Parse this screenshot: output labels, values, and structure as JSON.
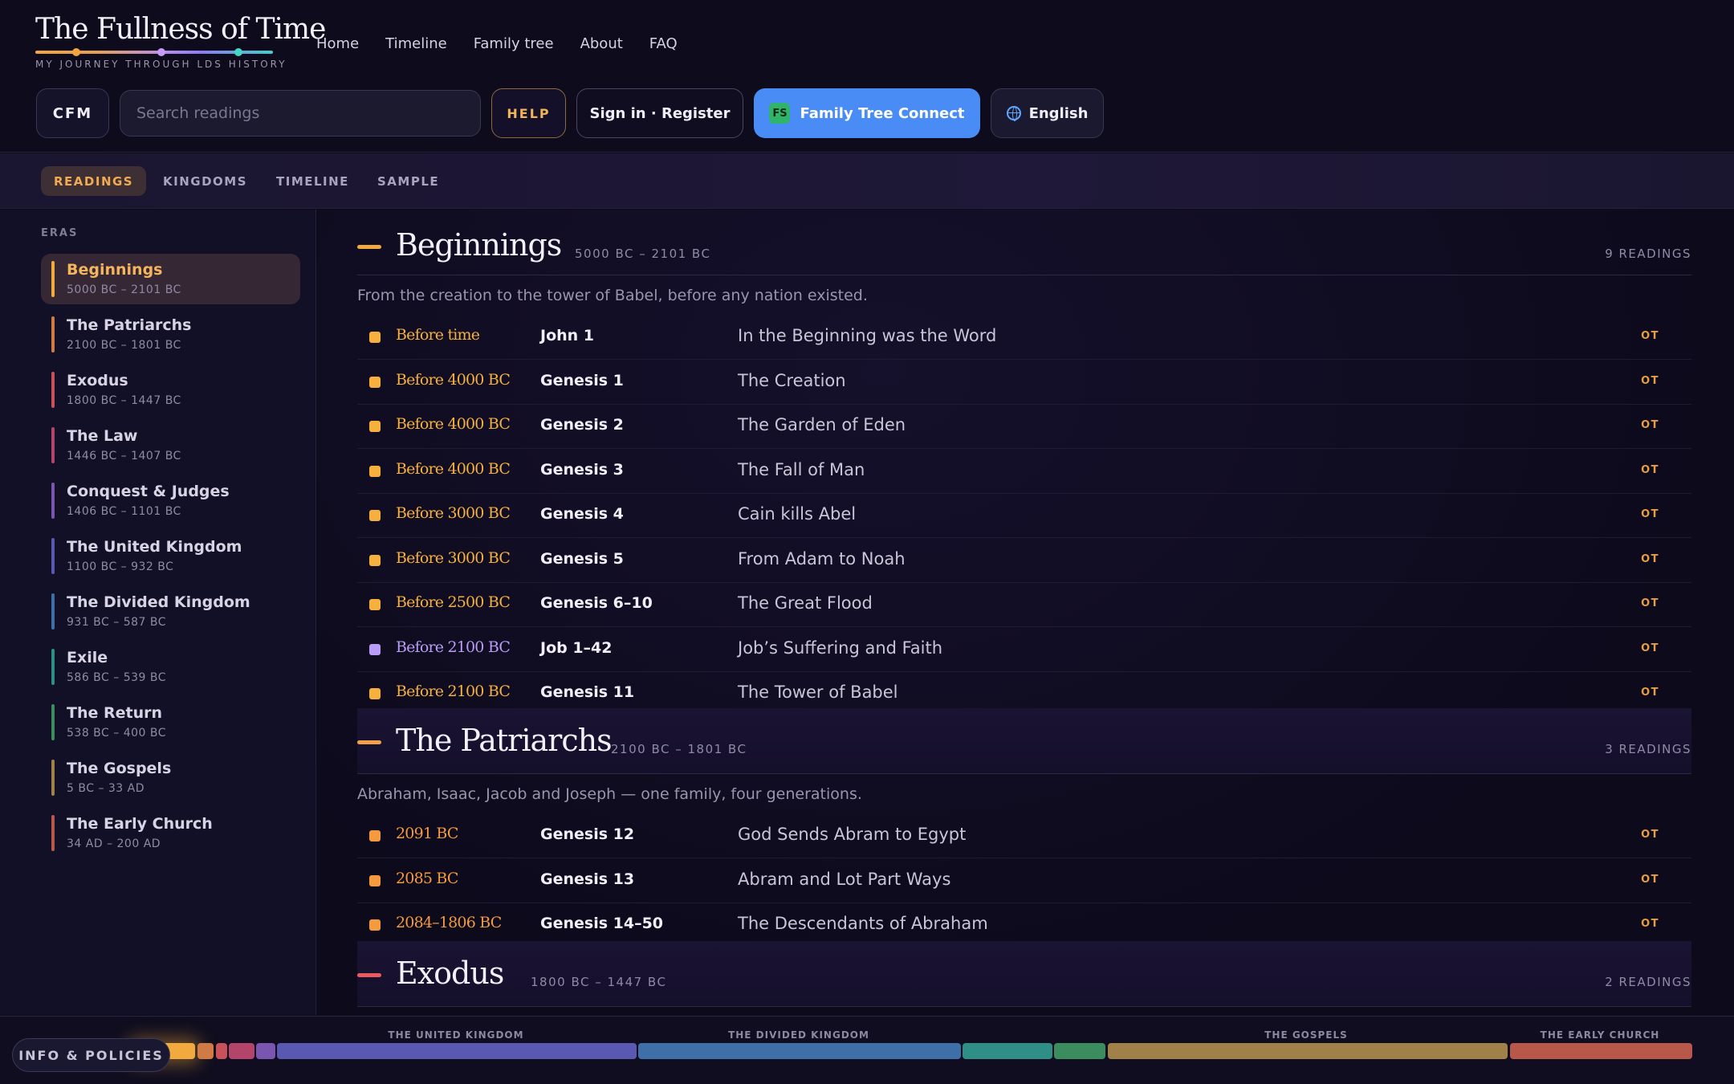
{
  "brand": {
    "title": "The Fullness of Time",
    "subtitle": "MY JOURNEY THROUGH LDS HISTORY"
  },
  "nav": [
    "Home",
    "Timeline",
    "Family tree",
    "About",
    "FAQ"
  ],
  "toolbar": {
    "cfm": "CFM",
    "search_placeholder": "Search readings",
    "help": "HELP",
    "sign_in": "Sign in · Register",
    "family_tree_connect": "Family Tree Connect",
    "fs_badge": "FS",
    "language": "English"
  },
  "tabs": [
    "READINGS",
    "KINGDOMS",
    "TIMELINE",
    "SAMPLE"
  ],
  "sidebar": {
    "label": "ERAS",
    "eras": [
      {
        "name": "Beginnings",
        "range": "5000 BC – 2101 BC",
        "color": "#f2a93e"
      },
      {
        "name": "The Patriarchs",
        "range": "2100 BC – 1801 BC",
        "color": "#d07a45"
      },
      {
        "name": "Exodus",
        "range": "1800 BC – 1447 BC",
        "color": "#c9515a"
      },
      {
        "name": "The Law",
        "range": "1446 BC – 1407 BC",
        "color": "#b4456a"
      },
      {
        "name": "Conquest & Judges",
        "range": "1406 BC – 1101 BC",
        "color": "#7a56b0"
      },
      {
        "name": "The United Kingdom",
        "range": "1100 BC – 932 BC",
        "color": "#5a58b0"
      },
      {
        "name": "The Divided Kingdom",
        "range": "931 BC – 587 BC",
        "color": "#3f6fa8"
      },
      {
        "name": "Exile",
        "range": "586 BC – 539 BC",
        "color": "#2f8f86"
      },
      {
        "name": "The Return",
        "range": "538 BC – 400 BC",
        "color": "#3c8d5e"
      },
      {
        "name": "The Gospels",
        "range": "5 BC – 33 AD",
        "color": "#a0814a"
      },
      {
        "name": "The Early Church",
        "range": "34 AD – 200 AD",
        "color": "#b7584a"
      }
    ]
  },
  "sections": [
    {
      "title": "Beginnings",
      "range": "5000 BC – 2101 BC",
      "count": "9 READINGS",
      "description": "From the creation to the tower of Babel, before any nation existed.",
      "color": "#f2a93e",
      "readings": [
        {
          "date": "Before time",
          "ref": "John 1",
          "title": "In the Beginning was the Word",
          "tag": "OT",
          "color": "#f5b03e"
        },
        {
          "date": "Before 4000 BC",
          "ref": "Genesis 1",
          "title": "The Creation",
          "tag": "OT",
          "color": "#f5b03e"
        },
        {
          "date": "Before 4000 BC",
          "ref": "Genesis 2",
          "title": "The Garden of Eden",
          "tag": "OT",
          "color": "#f5b03e"
        },
        {
          "date": "Before 4000 BC",
          "ref": "Genesis 3",
          "title": "The Fall of Man",
          "tag": "OT",
          "color": "#f5b03e"
        },
        {
          "date": "Before 3000 BC",
          "ref": "Genesis 4",
          "title": "Cain kills Abel",
          "tag": "OT",
          "color": "#f5b03e"
        },
        {
          "date": "Before 3000 BC",
          "ref": "Genesis 5",
          "title": "From Adam to Noah",
          "tag": "OT",
          "color": "#f5b03e"
        },
        {
          "date": "Before 2500 BC",
          "ref": "Genesis 6–10",
          "title": "The Great Flood",
          "tag": "OT",
          "color": "#f5b03e"
        },
        {
          "date": "Before 2100 BC",
          "ref": "Job 1–42",
          "title": "Job’s Suffering and Faith",
          "tag": "OT",
          "color": "#b99cf5"
        },
        {
          "date": "Before 2100 BC",
          "ref": "Genesis 11",
          "title": "The Tower of Babel",
          "tag": "OT",
          "color": "#f5b03e"
        }
      ]
    },
    {
      "title": "The Patriarchs",
      "range": "2100 BC – 1801 BC",
      "count": "3 READINGS",
      "description": "Abraham, Isaac, Jacob and Joseph — one family, four generations.",
      "color": "#f2a04a",
      "readings": [
        {
          "date": "2091 BC",
          "ref": "Genesis 12",
          "title": "God Sends Abram to Egypt",
          "tag": "OT",
          "color": "#f59a3e"
        },
        {
          "date": "2085 BC",
          "ref": "Genesis 13",
          "title": "Abram and Lot Part Ways",
          "tag": "OT",
          "color": "#f59a3e"
        },
        {
          "date": "2084–1806 BC",
          "ref": "Genesis 14–50",
          "title": "The Descendants of Abraham",
          "tag": "OT",
          "color": "#f59a3e"
        }
      ]
    },
    {
      "title": "Exodus",
      "range": "1800 BC – 1447 BC",
      "count": "2 READINGS",
      "description": "",
      "color": "#ea5a5e",
      "readings": []
    }
  ],
  "footer": {
    "info": "INFO & POLICIES",
    "timeline_labels": [
      "THE UNITED KINGDOM",
      "THE DIVIDED KINGDOM",
      "THE GOSPELS",
      "THE EARLY CHURCH"
    ]
  }
}
